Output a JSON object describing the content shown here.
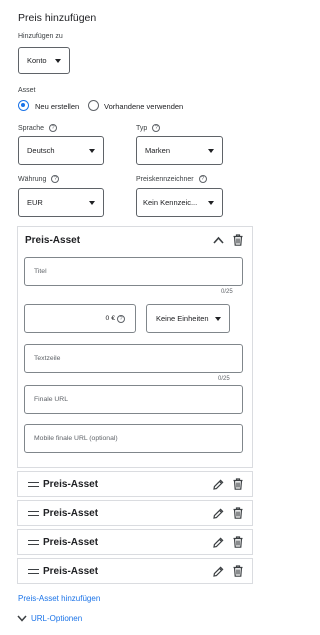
{
  "header": {
    "title": "Preis hinzufügen"
  },
  "add_to": {
    "label": "Hinzufügen zu",
    "value": "Konto"
  },
  "asset": {
    "label": "Asset",
    "options": [
      {
        "label": "Neu erstellen",
        "selected": true
      },
      {
        "label": "Vorhandene verwenden",
        "selected": false
      }
    ]
  },
  "language": {
    "label": "Sprache",
    "value": "Deutsch"
  },
  "type": {
    "label": "Typ",
    "value": "Marken"
  },
  "currency": {
    "label": "Währung",
    "value": "EUR"
  },
  "price_qualifier": {
    "label": "Preiskennzeichner",
    "value": "Kein Kennzeic..."
  },
  "expanded_asset": {
    "title": "Preis-Asset",
    "title_field": {
      "placeholder": "Titel",
      "counter": "0/25"
    },
    "price_field": {
      "value": "0 €"
    },
    "units": {
      "value": "Keine Einheiten"
    },
    "text_line": {
      "placeholder": "Textzeile",
      "counter": "0/25"
    },
    "final_url": {
      "placeholder": "Finale URL"
    },
    "mobile_url": {
      "placeholder": "Mobile finale URL (optional)"
    }
  },
  "collapsed_assets": [
    {
      "title": "Preis-Asset"
    },
    {
      "title": "Preis-Asset"
    },
    {
      "title": "Preis-Asset"
    },
    {
      "title": "Preis-Asset"
    }
  ],
  "add_asset_link": "Preis-Asset hinzufügen",
  "url_options": "URL-Optionen",
  "icons": {
    "help": "help-circle-icon",
    "collapse": "chevron-up-icon",
    "delete": "trash-icon",
    "edit": "pencil-icon",
    "drag": "drag-handle-icon",
    "expand": "chevron-down-icon"
  },
  "colors": {
    "accent": "#1a73e8",
    "text": "#202124",
    "border": "#dadce0"
  }
}
